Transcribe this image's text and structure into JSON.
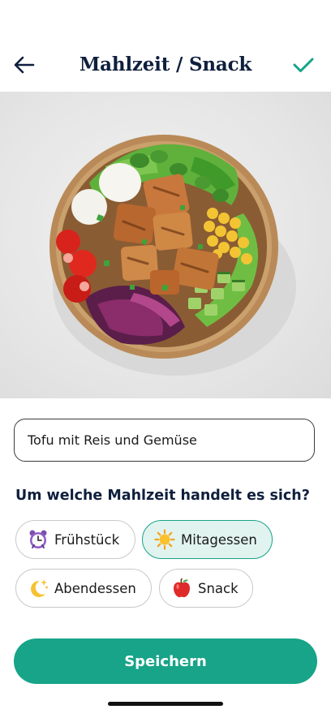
{
  "header": {
    "title": "Mahlzeit / Snack",
    "back_icon": "arrow-left-icon",
    "confirm_icon": "checkmark-icon"
  },
  "photo": {
    "subject": "food-bowl-image"
  },
  "meal_name": {
    "value": "Tofu mit Reis und Gemüse"
  },
  "question": "Um welche Mahlzeit handelt es sich?",
  "meal_types": [
    {
      "label": "Frühstück",
      "icon": "alarm-clock-icon",
      "selected": false
    },
    {
      "label": "Mitagessen",
      "icon": "sun-icon",
      "selected": true
    },
    {
      "label": "Abendessen",
      "icon": "crescent-moon-stars-icon",
      "selected": false
    },
    {
      "label": "Snack",
      "icon": "apple-icon",
      "selected": false
    }
  ],
  "save_label": "Speichern",
  "colors": {
    "accent": "#17a488",
    "selected_bg": "#e1f3ef",
    "title": "#0f1f3d"
  }
}
